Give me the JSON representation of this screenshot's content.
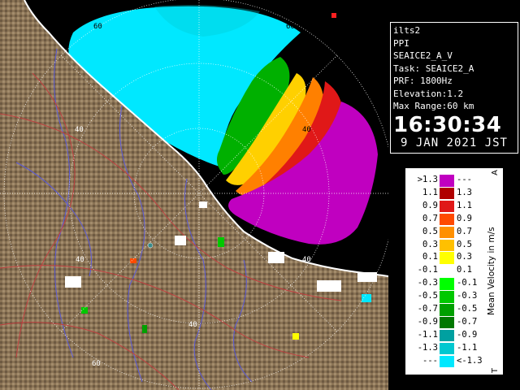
{
  "info": {
    "station": "ilts2",
    "product": "PPI",
    "dataset": "SEAICE2_A_V",
    "task": "Task: SEAICE2_A",
    "prf": "PRF: 1800Hz",
    "elevation": "Elevation:1.2",
    "max_range": "Max Range:60 km",
    "time": "16:30:34",
    "date": "9 JAN 2021 JST"
  },
  "range_ring_labels": {
    "r40": "40",
    "r60": "60"
  },
  "legend": {
    "unit": "Mean Velocity in m/s",
    "top_marker": "A",
    "bottom_marker": "T",
    "rows": [
      {
        "lo": ">1.3",
        "hi": "---",
        "color": "#c000c0"
      },
      {
        "lo": "1.1",
        "hi": "1.3",
        "color": "#b00000"
      },
      {
        "lo": "0.9",
        "hi": "1.1",
        "color": "#e01818"
      },
      {
        "lo": "0.7",
        "hi": "0.9",
        "color": "#ff4a00"
      },
      {
        "lo": "0.5",
        "hi": "0.7",
        "color": "#ff9000"
      },
      {
        "lo": "0.3",
        "hi": "0.5",
        "color": "#ffc000"
      },
      {
        "lo": "0.1",
        "hi": "0.3",
        "color": "#ffff00"
      },
      {
        "lo": "-0.1",
        "hi": "0.1",
        "color": "#ffffff"
      },
      {
        "lo": "-0.3",
        "hi": "-0.1",
        "color": "#00ff00"
      },
      {
        "lo": "-0.5",
        "hi": "-0.3",
        "color": "#00c800"
      },
      {
        "lo": "-0.7",
        "hi": "-0.5",
        "color": "#00a000"
      },
      {
        "lo": "-0.9",
        "hi": "-0.7",
        "color": "#007800"
      },
      {
        "lo": "-1.1",
        "hi": "-0.9",
        "color": "#00a0a0"
      },
      {
        "lo": "-1.3",
        "hi": "-1.1",
        "color": "#00c8d0"
      },
      {
        "lo": "---",
        "hi": "<-1.3",
        "color": "#00e8ff"
      }
    ]
  },
  "colors": {
    "land": "#8a7355",
    "ocean": "#000000",
    "coastline": "#ffffff",
    "rivers": "#5a5ad8",
    "roads": "#c04040",
    "rings": "#ffffff"
  }
}
